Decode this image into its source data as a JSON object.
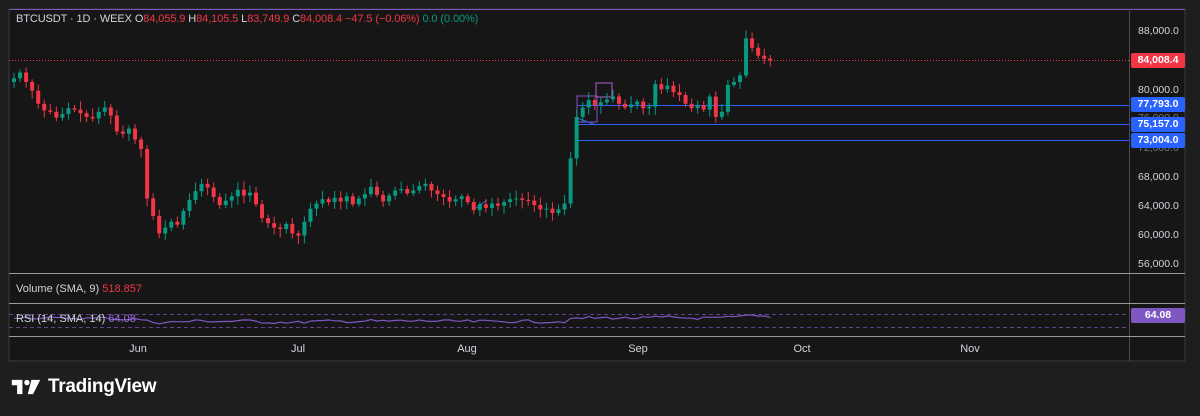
{
  "header": {
    "symbol": "BTCUSDT · 1D · WEEX",
    "open_label": "O",
    "open": "84,055.9",
    "high_label": "H",
    "high": "84,105.5",
    "low_label": "L",
    "low": "83,749.9",
    "close_label": "C",
    "close": "84,008.4",
    "change": "−47.5 (−0.06%)",
    "extra": "0.0 (0.00%)"
  },
  "volume_pane": {
    "label": "Volume (SMA, 9)",
    "value": "518.857"
  },
  "rsi_pane": {
    "label": "RSI (14, SMA, 14)",
    "value": "64.08",
    "badge": "64.08"
  },
  "price_badges": {
    "last": "84,008.4",
    "level1": "77,793.0",
    "level2": "75,157.0",
    "level3": "73,004.0"
  },
  "price_axis": [
    "88,000.0",
    "80,000.0",
    "76,000.0",
    "72,000.0",
    "68,000.0",
    "64,000.0",
    "60,000.0",
    "56,000.0"
  ],
  "time_axis": [
    "Jun",
    "Jul",
    "Aug",
    "Sep",
    "Oct",
    "Nov"
  ],
  "brand": {
    "name": "TradingView"
  },
  "colors": {
    "up": "#089981",
    "down": "#f23645",
    "level_line": "#2962ff",
    "rsi": "#7e57c2",
    "background": "#161616"
  },
  "chart_data": {
    "type": "candlestick",
    "symbol": "BTCUSDT",
    "interval": "1D",
    "ylim": [
      55000,
      90000
    ],
    "x": [
      "Jun",
      "Jul",
      "Aug",
      "Sep",
      "Oct",
      "Nov"
    ],
    "levels": [
      77793.0,
      75157.0,
      73004.0
    ],
    "last_price": 84008.4,
    "closes": [
      81500,
      82300,
      81000,
      79800,
      78000,
      77100,
      76900,
      76100,
      76600,
      77400,
      77200,
      76700,
      76200,
      76000,
      76900,
      77500,
      76400,
      74200,
      73900,
      74600,
      73100,
      71800,
      65000,
      62600,
      60200,
      61000,
      61800,
      61400,
      63300,
      64800,
      66000,
      67000,
      66500,
      65200,
      64100,
      64700,
      65300,
      66200,
      65400,
      65800,
      64200,
      62300,
      61600,
      61000,
      60800,
      61500,
      60200,
      59900,
      61800,
      63600,
      64300,
      64900,
      64500,
      65100,
      64600,
      65300,
      64200,
      65000,
      65600,
      66600,
      65500,
      64600,
      65400,
      66100,
      66300,
      65700,
      66100,
      66700,
      67000,
      66100,
      65600,
      65200,
      64600,
      64900,
      65300,
      64500,
      63400,
      64200,
      63700,
      64300,
      64000,
      64500,
      64900,
      65000,
      64800,
      64700,
      64100,
      63500,
      63600,
      63000,
      63500,
      64300,
      70500,
      76200,
      77500,
      78500,
      77800,
      78200,
      78600,
      79000,
      78000,
      77500,
      77900,
      78300,
      77400,
      77600,
      80700,
      80000,
      80500,
      79600,
      79200,
      78000,
      77400,
      77800,
      77200,
      79000,
      76200,
      76900,
      80600,
      81000,
      81900,
      87000,
      85700,
      84600,
      84200,
      84008
    ]
  }
}
